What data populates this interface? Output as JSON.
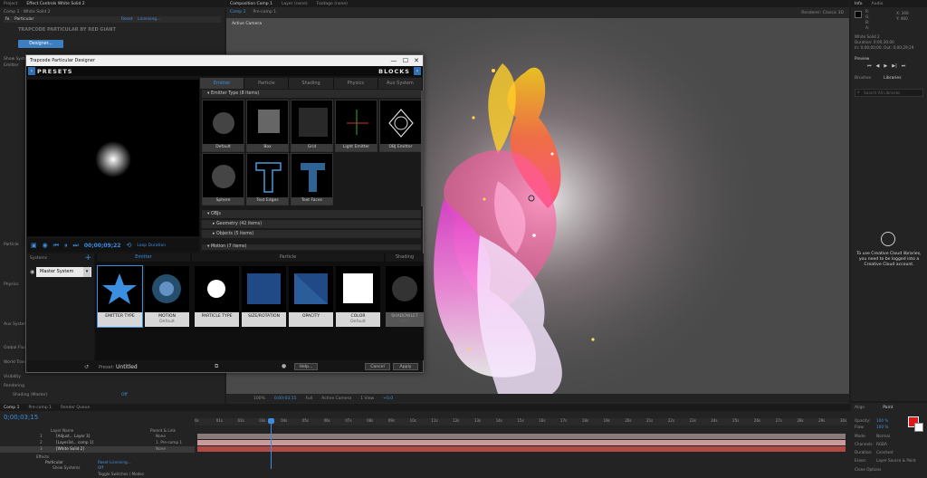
{
  "app": {
    "top_tabs_left": [
      "Project",
      "Effect Controls White Solid 2"
    ],
    "top_tabs_center": [
      "Composition Comp 1",
      "Layer (none)",
      "Footage (none)"
    ],
    "top_tabs_right": [
      "Info",
      "Audio"
    ],
    "effect_controls_subtitle": "Comp 1 · White Solid 2",
    "effect_name": "Particular",
    "effect_reset": "Reset",
    "effect_licensing": "Licensing...",
    "effect_vendor": "TRAPCODE PARTICULAR BY RED GIANT",
    "designer_button": "Designer...",
    "effect_rows": [
      "Show Systems",
      "Emitter",
      "Particle",
      "Physics",
      "Aux System",
      "Global Fluid Controls",
      "World Transform",
      "Visibility",
      "Rendering",
      "Shading (Master)"
    ],
    "effect_row_values": [
      "",
      "",
      "",
      "",
      "",
      "",
      "",
      "",
      "",
      "Off"
    ],
    "comp_tabs": [
      "Comp 1",
      "Pre-comp 1"
    ],
    "active_camera": "Active Camera",
    "renderer": "Renderer: Classic 3D"
  },
  "dialog": {
    "title": "Trapcode Particular Designer",
    "close": "✕",
    "minimize": "—",
    "maximize": "☐",
    "presets_label": "PRESETS",
    "blocks_label": "BLOCKS",
    "timecode": "00;00;09;22",
    "loop_label": "Loop Duration",
    "block_tabs": [
      "Emitter",
      "Particle",
      "Shading",
      "Physics",
      "Aux System"
    ],
    "emitter_type_header": "Emitter Type  (8 items)",
    "emitter_types": [
      "Default",
      "Box",
      "Grid",
      "Light Emitter",
      "OBJ Emitter",
      "Sphere",
      "Text Edges",
      "Text Faces"
    ],
    "objs_header": "OBJs",
    "geometry_header": "Geometry  (42 items)",
    "objects_header": "Objects  (5 items)",
    "motion_header": "Motion  (7 items)",
    "systems_label": "Systems",
    "systems_add": "+",
    "master_system": "Master System",
    "strip_sections": [
      "Emitter",
      "Particle",
      "Shading"
    ],
    "strip_cards": [
      {
        "title": "EMITTER TYPE",
        "sub": ""
      },
      {
        "title": "MOTION",
        "sub": "Default"
      },
      {
        "title": "PARTICLE TYPE",
        "sub": ""
      },
      {
        "title": "SIZE/ROTATION",
        "sub": ""
      },
      {
        "title": "OPACITY",
        "sub": ""
      },
      {
        "title": "COLOR",
        "sub": "Default"
      },
      {
        "title": "SHADOWLET",
        "sub": "OFF"
      }
    ],
    "preset_label": "Preset:",
    "preset_value": "Untitled",
    "help_button": "Help...",
    "cancel_button": "Cancel",
    "apply_button": "Apply"
  },
  "viewer": {
    "zoom": "100%",
    "timecode": "0;00;03;15",
    "quality": "Full",
    "camera": "Active Camera",
    "view": "1 View",
    "exposure": "+0.0"
  },
  "right": {
    "info_labels": [
      "R:",
      "G:",
      "B:",
      "A:"
    ],
    "info_coords": [
      "X: 346",
      "Y: 460"
    ],
    "info_solid": "White Solid 2",
    "info_duration": "Duration: 0;00;30;00",
    "info_inout": "In: 0;00;00;00, Out: 0;00;29;29",
    "preview_title": "Preview",
    "tabs_mid": [
      "Brushes",
      "Libraries"
    ],
    "search_placeholder": "Search All Libraries",
    "cc_message": "To use Creative Cloud libraries, you need to be logged into a Creative Cloud account.",
    "bottom_tabs": [
      "Align",
      "Paint"
    ],
    "paint_labels": [
      "Opacity:",
      "Flow:",
      "Mode:",
      "Channels:",
      "Duration:",
      "Erase:",
      "Clone Options"
    ],
    "paint_values": [
      "100 %",
      "100 %",
      "Normal",
      "RGBA",
      "Constant",
      "Layer Source & Paint",
      ""
    ]
  },
  "timeline": {
    "tabs": [
      "Comp 1",
      "Pre-comp 1",
      "Render Queue"
    ],
    "timecode": "0;00;03;15",
    "columns": [
      "Layer Name",
      "Parent & Link"
    ],
    "layers": [
      {
        "num": "1",
        "name": "[Adjust... Layer 3]",
        "parent": "None"
      },
      {
        "num": "2",
        "name": "[Layer3d... comp 1]",
        "parent": "1. Pre-comp 1"
      },
      {
        "num": "3",
        "name": "[White Solid 2]",
        "parent": "None"
      }
    ],
    "effects_rows": [
      "Effects",
      "Particular",
      "Show Systems"
    ],
    "effects_values": [
      "",
      "Reset  Licensing...",
      "Off"
    ],
    "toggle_label": "Toggle Switches / Modes",
    "ruler_ticks": [
      "0s",
      "01s",
      "02s",
      "03s",
      "04s",
      "05s",
      "06s",
      "07s",
      "08s",
      "09s",
      "10s",
      "11s",
      "12s",
      "13s",
      "14s",
      "15s",
      "16s",
      "17s",
      "18s",
      "19s",
      "20s",
      "21s",
      "22s",
      "23s",
      "24s",
      "25s",
      "26s",
      "27s",
      "28s",
      "29s",
      "30s"
    ]
  },
  "colors": {
    "accent_blue": "#3c8ee0",
    "layer_red": "#b24a4a",
    "layer_pink": "#c89a9a",
    "paint_fg": "#e21818"
  }
}
